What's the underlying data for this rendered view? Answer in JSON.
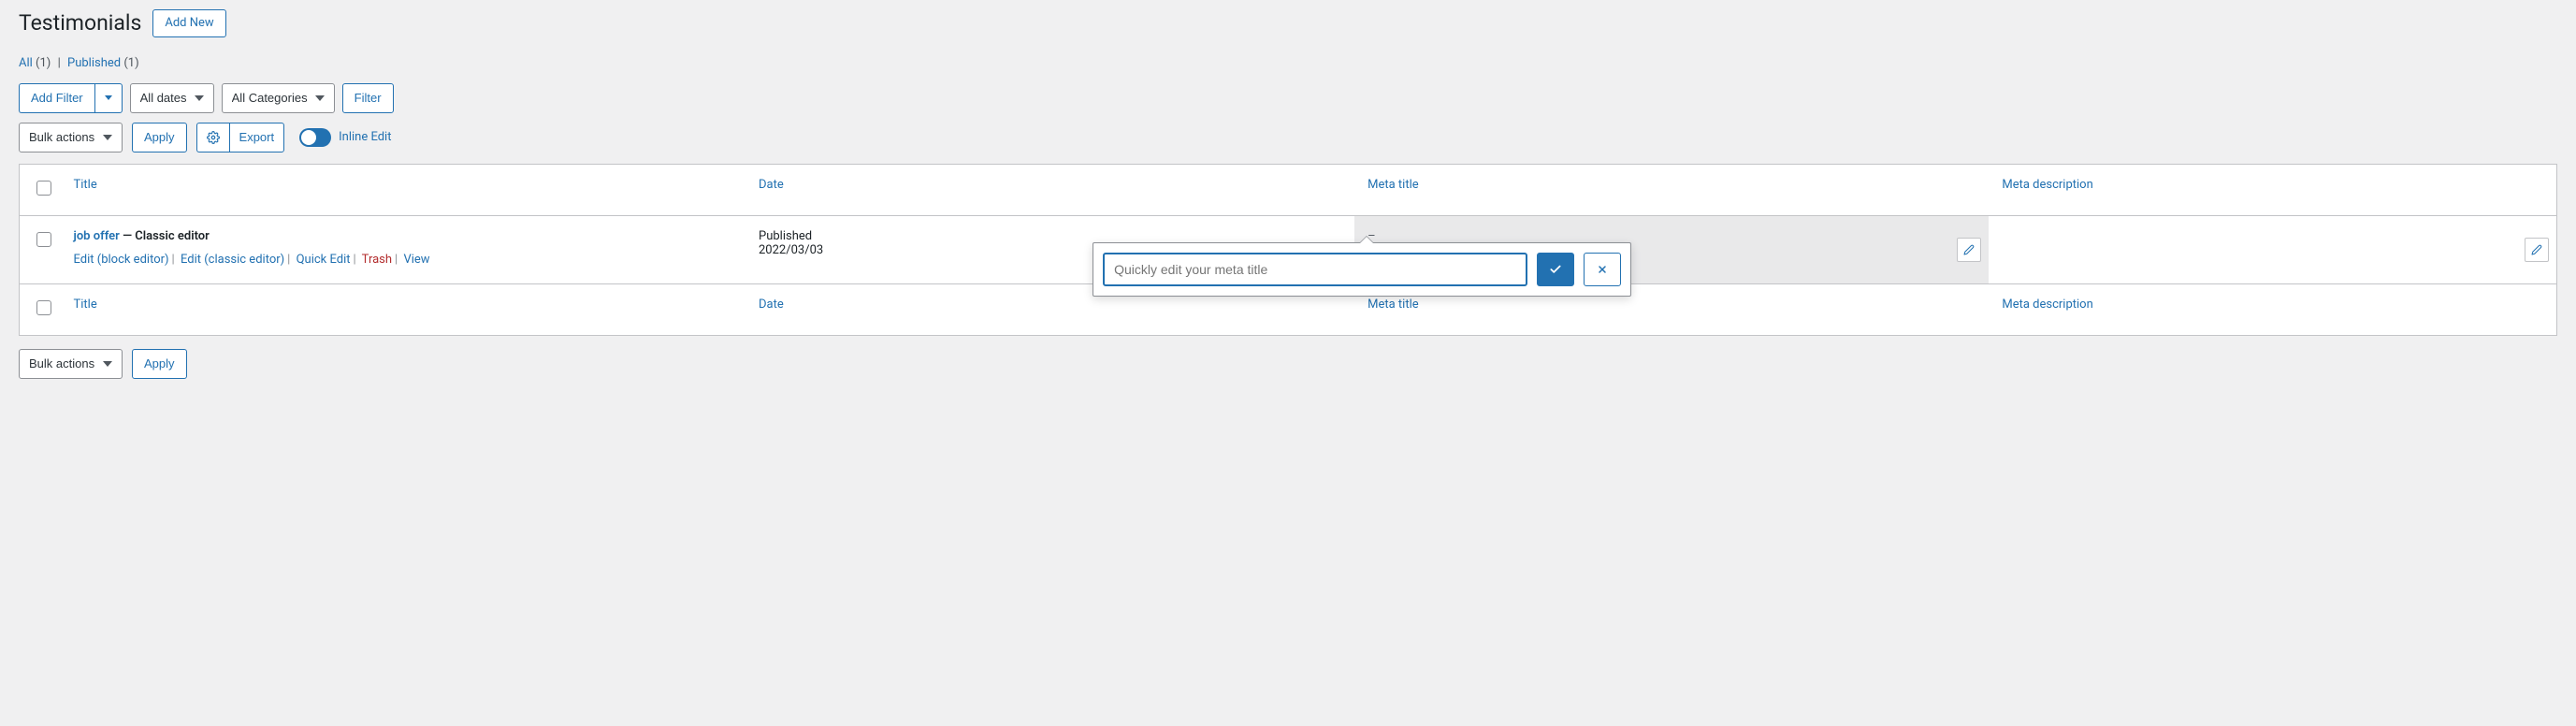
{
  "header": {
    "title": "Testimonials",
    "add_new": "Add New"
  },
  "statuses": {
    "all_label": "All",
    "all_count": "(1)",
    "published_label": "Published",
    "published_count": "(1)"
  },
  "filter_row": {
    "add_filter": "Add Filter",
    "all_dates": "All dates",
    "all_categories": "All Categories",
    "filter": "Filter"
  },
  "action_row": {
    "bulk_actions": "Bulk actions",
    "apply": "Apply",
    "export": "Export",
    "inline_edit": "Inline Edit"
  },
  "columns": {
    "title": "Title",
    "date": "Date",
    "meta_title": "Meta title",
    "meta_desc": "Meta description"
  },
  "row": {
    "title_link": "job offer",
    "title_suffix": " — Classic editor",
    "actions": {
      "edit_block": "Edit (block editor)",
      "edit_classic": "Edit (classic editor)",
      "quick_edit": "Quick Edit",
      "trash": "Trash",
      "view": "View"
    },
    "date_status": "Published",
    "date_value": "2022/03/03",
    "meta_title_placeholder": "–"
  },
  "popover": {
    "placeholder": "Quickly edit your meta title"
  },
  "bottom": {
    "bulk_actions": "Bulk actions",
    "apply": "Apply"
  }
}
